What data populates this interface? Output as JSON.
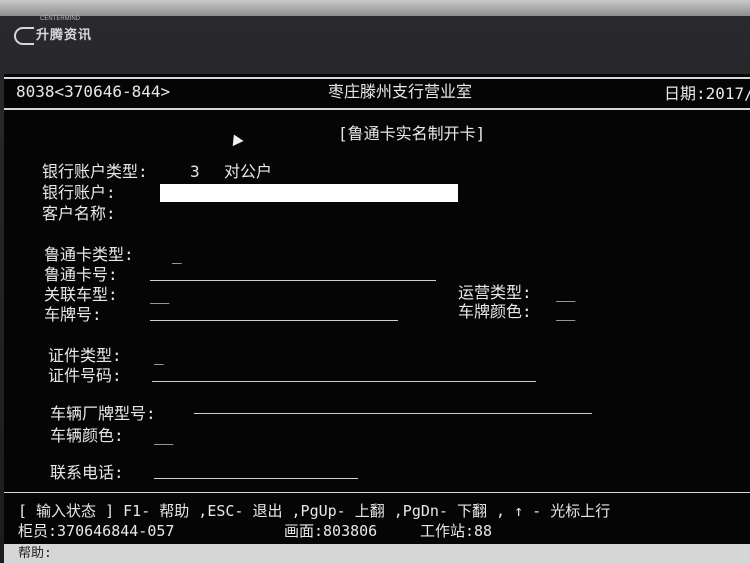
{
  "brand": {
    "name": "升腾资讯",
    "sub": "CENTERMIND"
  },
  "header": {
    "terminal_id": "8038<370646-844>",
    "branch": "枣庄滕州支行营业室",
    "date_label": "日期:2017/"
  },
  "form": {
    "title": "[鲁通卡实名制开卡]",
    "account_type_label": "银行账户类型:",
    "account_type_value": "3",
    "account_type_desc": "对公户",
    "account_label": "银行账户:",
    "customer_name_label": "客户名称:",
    "card_type_label": "鲁通卡类型:",
    "card_type_value": "_",
    "card_no_label": "鲁通卡号:",
    "vehicle_type_label": "关联车型:",
    "vehicle_type_value": "__",
    "operation_type_label": "运营类型:",
    "operation_type_value": "__",
    "plate_no_label": "车牌号:",
    "plate_color_label": "车牌颜色:",
    "plate_color_value": "__",
    "id_type_label": "证件类型:",
    "id_type_value": "_",
    "id_no_label": "证件号码:",
    "vehicle_model_label": "车辆厂牌型号:",
    "vehicle_color_label": "车辆颜色:",
    "vehicle_color_value": "__",
    "phone_label": "联系电话:"
  },
  "status": {
    "line": "[ 输入状态 ] F1- 帮助 ,ESC- 退出 ,PgUp- 上翻 ,PgDn- 下翻 , ↑ - 光标上行",
    "teller": "柜员:370646844-057",
    "screen": "画面:803806",
    "workstation": "工作站:88",
    "help": "帮助:"
  }
}
